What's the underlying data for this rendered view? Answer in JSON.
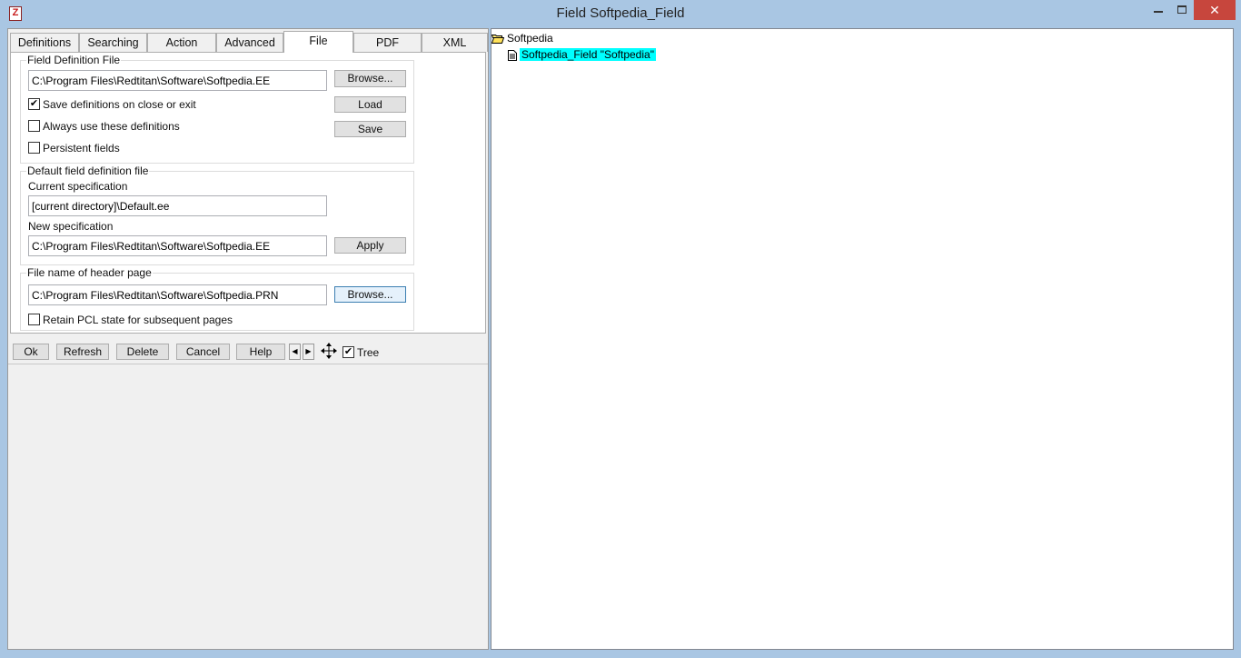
{
  "window": {
    "title": "Field Softpedia_Field",
    "icon_glyph": "Z",
    "minimize_label": "",
    "close_label": "✕"
  },
  "tabs": [
    {
      "label": "Definitions"
    },
    {
      "label": "Searching"
    },
    {
      "label": "Action"
    },
    {
      "label": "Advanced"
    },
    {
      "label": "File"
    },
    {
      "label": "PDF"
    },
    {
      "label": "XML"
    }
  ],
  "active_tab": "File",
  "field_definition_file": {
    "title": "Field Definition File",
    "path": "C:\\Program Files\\Redtitan\\Software\\Softpedia.EE",
    "browse_label": "Browse...",
    "load_label": "Load",
    "save_label": "Save",
    "save_on_close_label": "Save definitions on close or exit",
    "save_on_close_checked": true,
    "always_use_label": "Always use these definitions",
    "always_use_checked": false,
    "persistent_label": "Persistent fields",
    "persistent_checked": false
  },
  "default_definition": {
    "title": "Default field definition file",
    "current_label": "Current specification",
    "current_value": "[current directory]\\Default.ee",
    "new_label": "New specification",
    "new_value": "C:\\Program Files\\Redtitan\\Software\\Softpedia.EE",
    "apply_label": "Apply"
  },
  "header_page": {
    "title": "File name of header page",
    "path": "C:\\Program Files\\Redtitan\\Software\\Softpedia.PRN",
    "browse_label": "Browse...",
    "retain_label": "Retain PCL state for subsequent pages",
    "retain_checked": false
  },
  "bottom_bar": {
    "ok_label": "Ok",
    "refresh_label": "Refresh",
    "delete_label": "Delete",
    "cancel_label": "Cancel",
    "help_label": "Help",
    "prev_glyph": "◀",
    "next_glyph": "▶",
    "move_icon": "move-arrows-icon",
    "tree_label": "Tree",
    "tree_checked": true
  },
  "tree": {
    "root_label": "Softpedia",
    "root_icon": "open-folder-icon",
    "child_label": "Softpedia_Field \"Softpedia\"",
    "child_icon": "document-icon",
    "selected_color": "#00ffff"
  },
  "check_glyph": "✔"
}
